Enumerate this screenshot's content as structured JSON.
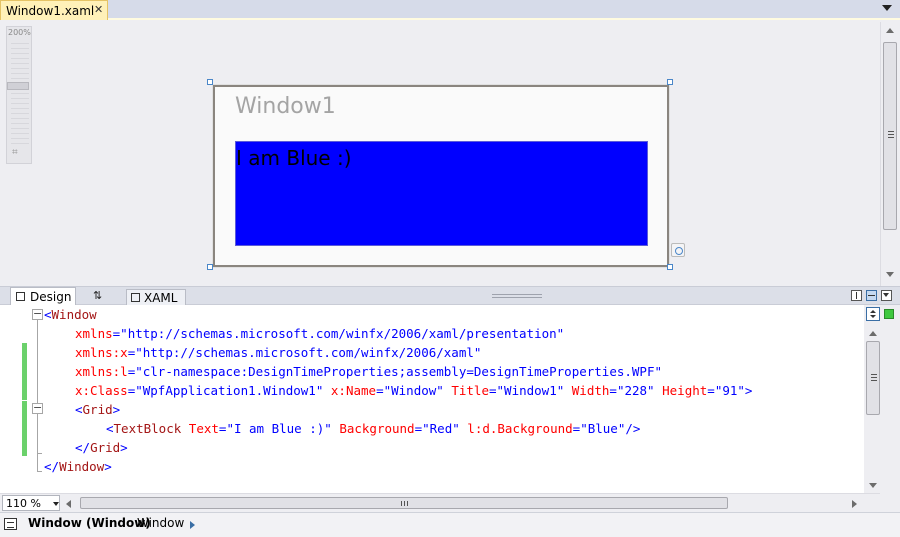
{
  "document_tab": {
    "title": "Window1.xaml",
    "close_glyph": "✕"
  },
  "designer": {
    "zoom_ruler_label": "200%",
    "window_title": "Window1",
    "textblock_text": "I am Blue :)",
    "textblock_background": "#0000ff"
  },
  "view_tabs": {
    "design_label": "Design",
    "swap_glyph": "⇅",
    "xaml_label": "XAML"
  },
  "code": {
    "colors": {
      "tag": "#a31515",
      "attr": "#ff0000",
      "value": "#0000ff",
      "gutter_change": "#6bd16b"
    },
    "lines": [
      {
        "open": "<",
        "tag": "Window"
      },
      {
        "attr": "xmlns",
        "val": "\"http://schemas.microsoft.com/winfx/2006/xaml/presentation\""
      },
      {
        "attr": "xmlns:x",
        "val": "\"http://schemas.microsoft.com/winfx/2006/xaml\""
      },
      {
        "attr": "xmlns:l",
        "val": "\"clr-namespace:DesignTimeProperties;assembly=DesignTimeProperties.WPF\""
      },
      {
        "a1": "x:Class",
        "v1": "\"WpfApplication1.Window1\"",
        "a2": "x:Name",
        "v2": "\"Window\"",
        "a3": "Title",
        "v3": "\"Window1\"",
        "a4": "Width",
        "v4": "\"228\"",
        "a5": "Height",
        "v5": "\"91\"",
        "end": ">"
      },
      {
        "open": "<",
        "tag": "Grid",
        "close": ">"
      },
      {
        "open": "<",
        "tag": "TextBlock",
        "a1": "Text",
        "v1": "\"I am Blue :)\"",
        "a2": "Background",
        "v2": "\"Red\"",
        "a3": "l:d.Background",
        "v3": "\"Blue\"",
        "end": "/>"
      },
      {
        "open": "</",
        "tag": "Grid",
        "close": ">"
      },
      {
        "open": "</",
        "tag": "Window",
        "close": ">"
      }
    ]
  },
  "status": {
    "zoom": "110 %",
    "breadcrumb_selected": "Window (Window)",
    "breadcrumb_next": "Window"
  }
}
